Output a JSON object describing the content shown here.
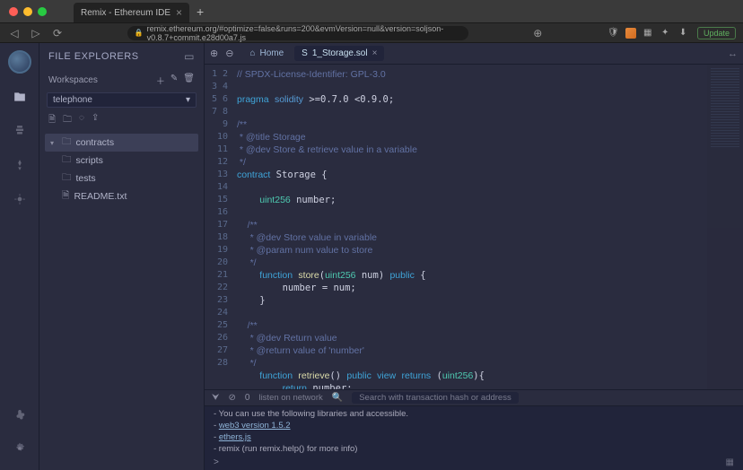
{
  "browser": {
    "tab_title": "Remix - Ethereum IDE",
    "url": "remix.ethereum.org/#optimize=false&runs=200&evmVersion=null&version=soljson-v0.8.7+commit.e28d00a7.js",
    "update_label": "Update"
  },
  "panel": {
    "title": "FILE EXPLORERS",
    "workspaces_label": "Workspaces",
    "workspace_selected": "telephone",
    "tree": {
      "contracts": "contracts",
      "scripts": "scripts",
      "tests": "tests",
      "readme": "README.txt"
    }
  },
  "tabs": {
    "home": "Home",
    "active": "1_Storage.sol"
  },
  "editor": {
    "line_count": 28,
    "lines": [
      {
        "t": "com",
        "s": "// SPDX-License-Identifier: GPL-3.0"
      },
      {
        "t": "",
        "s": ""
      },
      {
        "t": "raw",
        "s": "<span class='kw'>pragma</span> <span class='kw2'>solidity</span> &gt;=0.7.0 &lt;0.9.0;"
      },
      {
        "t": "",
        "s": ""
      },
      {
        "t": "com",
        "s": "/**"
      },
      {
        "t": "com",
        "s": " * @title Storage"
      },
      {
        "t": "com",
        "s": " * @dev Store & retrieve value in a variable"
      },
      {
        "t": "com",
        "s": " */"
      },
      {
        "t": "raw",
        "s": "<span class='kw'>contract</span> Storage {"
      },
      {
        "t": "",
        "s": ""
      },
      {
        "t": "raw",
        "s": "    <span class='ty'>uint256</span> number;"
      },
      {
        "t": "",
        "s": ""
      },
      {
        "t": "com",
        "s": "    /**"
      },
      {
        "t": "com",
        "s": "     * @dev Store value in variable"
      },
      {
        "t": "com",
        "s": "     * @param num value to store"
      },
      {
        "t": "com",
        "s": "     */"
      },
      {
        "t": "raw",
        "s": "    <span class='kw'>function</span> <span class='fn'>store</span>(<span class='ty'>uint256</span> num) <span class='kw'>public</span> {"
      },
      {
        "t": "",
        "s": "        number = num;"
      },
      {
        "t": "",
        "s": "    }"
      },
      {
        "t": "",
        "s": ""
      },
      {
        "t": "com",
        "s": "    /**"
      },
      {
        "t": "com",
        "s": "     * @dev Return value "
      },
      {
        "t": "com",
        "s": "     * @return value of 'number'"
      },
      {
        "t": "com",
        "s": "     */"
      },
      {
        "t": "raw",
        "s": "    <span class='kw'>function</span> <span class='fn'>retrieve</span>() <span class='kw'>public</span> <span class='kw'>view</span> <span class='kw'>returns</span> (<span class='ty'>uint256</span>){"
      },
      {
        "t": "raw",
        "s": "        <span class='kw'>return</span> number;"
      },
      {
        "t": "",
        "s": "    }"
      },
      {
        "t": "",
        "s": "}"
      }
    ]
  },
  "bottombar": {
    "count": "0",
    "listen": "listen on network",
    "search_placeholder": "Search with transaction hash or address"
  },
  "terminal": {
    "l1": "- You can use the following libraries and accessible.",
    "l2_prefix": "- ",
    "l2_link": "web3 version 1.5.2",
    "l3_prefix": "- ",
    "l3_link": "ethers.js",
    "l4": "- remix (run remix.help() for more info)",
    "prompt": ">"
  }
}
